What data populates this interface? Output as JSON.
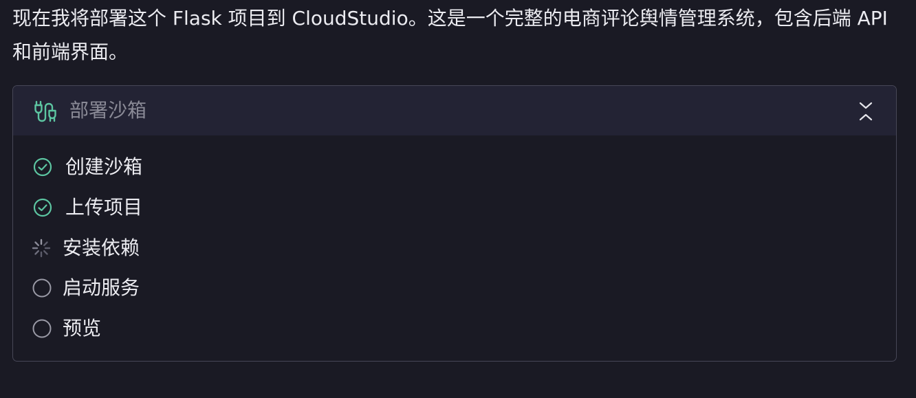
{
  "message": {
    "text": "现在我将部署这个 Flask 项目到 CloudStudio。这是一个完整的电商评论舆情管理系统，包含后端 API 和前端界面。"
  },
  "panel": {
    "title": "部署沙箱",
    "header_icon": "plug-icon",
    "collapse_icon": "collapse-chevrons-icon"
  },
  "steps": [
    {
      "label": "创建沙箱",
      "status": "completed",
      "icon": "check-circle-icon"
    },
    {
      "label": "上传项目",
      "status": "completed",
      "icon": "check-circle-icon"
    },
    {
      "label": "安装依赖",
      "status": "in-progress",
      "icon": "spinner-icon"
    },
    {
      "label": "启动服务",
      "status": "pending",
      "icon": "empty-circle-icon"
    },
    {
      "label": "预览",
      "status": "pending",
      "icon": "empty-circle-icon"
    }
  ],
  "colors": {
    "background": "#1a1a24",
    "header_background": "#232334",
    "border": "#474757",
    "accent_green": "#5dc6a2",
    "text": "#ececf1",
    "muted_text": "#8a8a96",
    "pending_icon": "#9a9aa6"
  }
}
